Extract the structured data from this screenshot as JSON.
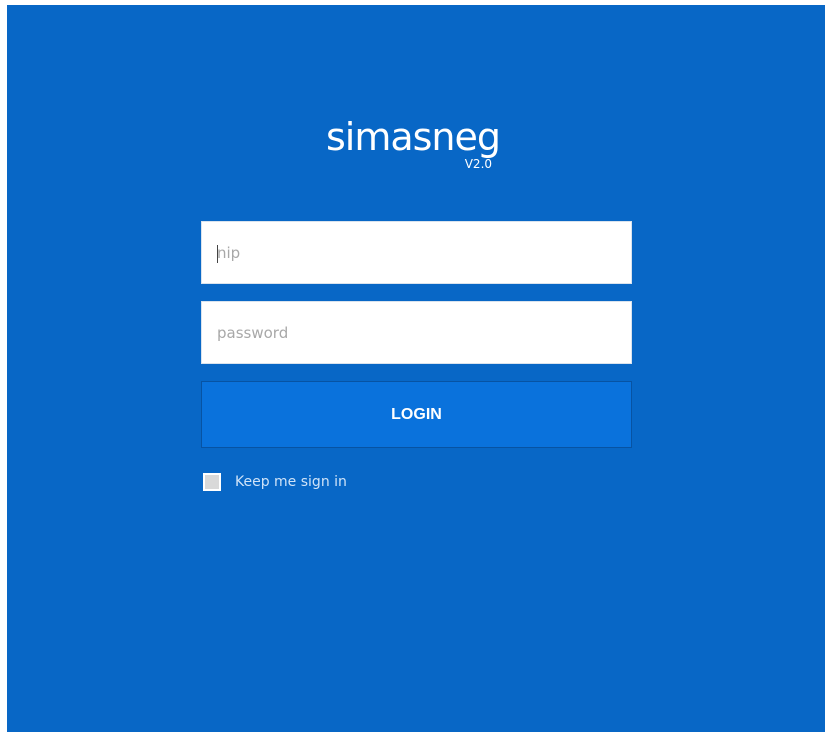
{
  "logo": {
    "name": "simasneg",
    "version": "V2.0"
  },
  "login_form": {
    "username_placeholder": "nip",
    "password_placeholder": "password",
    "login_label": "LOGIN",
    "remember_label": "Keep me sign in"
  },
  "colors": {
    "background": "#0867c6",
    "button": "#0a72dc",
    "input_background": "#ffffff"
  }
}
